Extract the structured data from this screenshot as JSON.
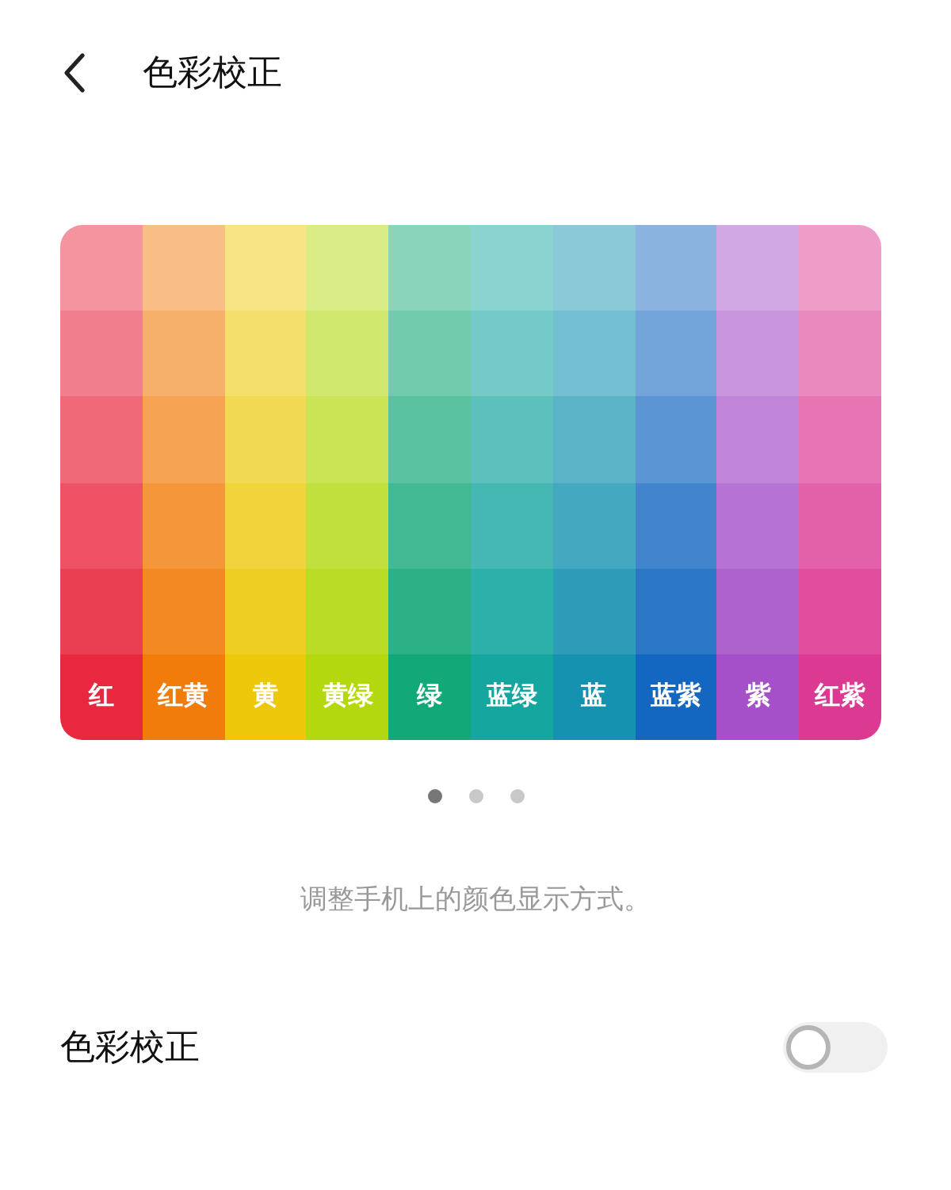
{
  "header": {
    "title": "色彩校正"
  },
  "palette": [
    {
      "label": "红",
      "color": "#e8283f"
    },
    {
      "label": "红黄",
      "color": "#f27c0a"
    },
    {
      "label": "黄",
      "color": "#edc80a"
    },
    {
      "label": "黄绿",
      "color": "#b3d80d"
    },
    {
      "label": "绿",
      "color": "#13a877"
    },
    {
      "label": "蓝绿",
      "color": "#16a6a0"
    },
    {
      "label": "蓝",
      "color": "#1592b0"
    },
    {
      "label": "蓝紫",
      "color": "#1467c0"
    },
    {
      "label": "紫",
      "color": "#a550c8"
    },
    {
      "label": "红紫",
      "color": "#dc3a92"
    }
  ],
  "pager": [
    {
      "selected": true
    },
    {
      "selected": false
    },
    {
      "selected": false
    }
  ],
  "description": "调整手机上的颜色显示方式。",
  "setting": {
    "label": "色彩校正",
    "on": false
  }
}
